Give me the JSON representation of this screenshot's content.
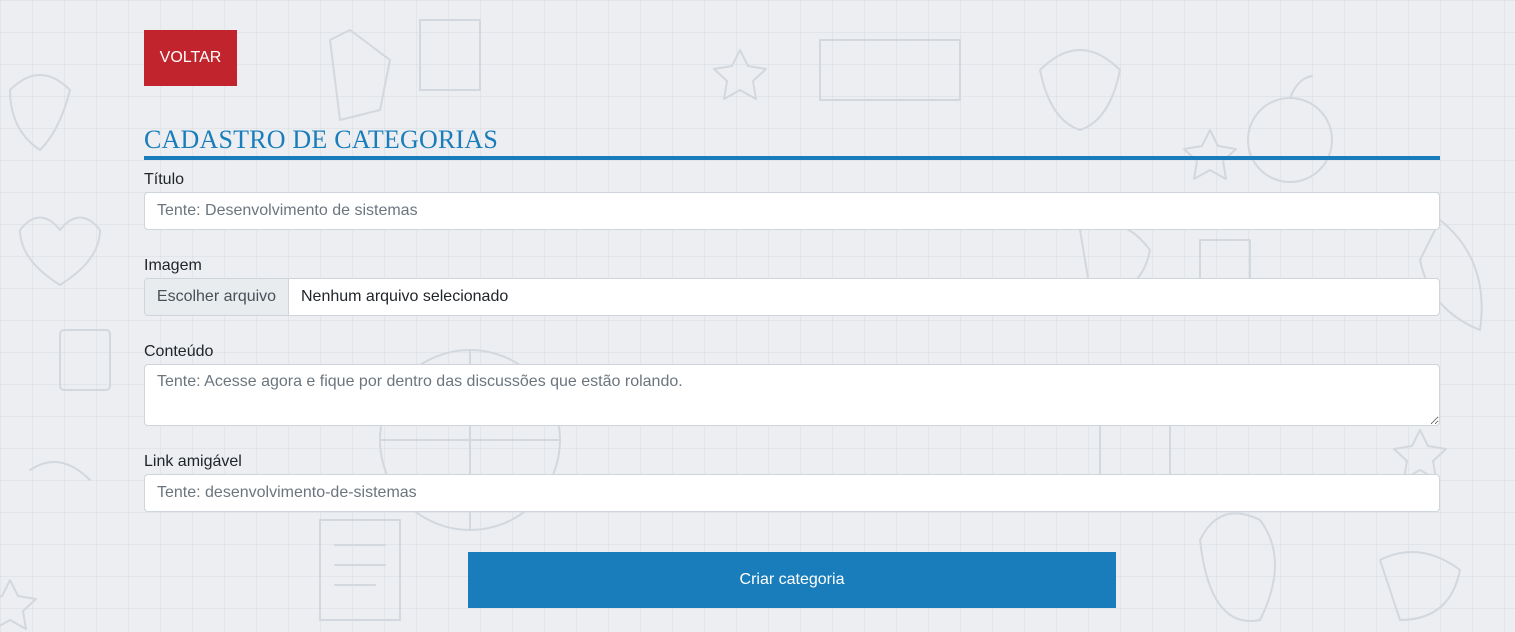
{
  "back_button": {
    "label": "VOLTAR"
  },
  "page_title": "CADASTRO DE CATEGORIAS",
  "form": {
    "title_field": {
      "label": "Título",
      "placeholder": "Tente: Desenvolvimento de sistemas",
      "value": ""
    },
    "image_field": {
      "label": "Imagem",
      "button_label": "Escolher arquivo",
      "file_status": "Nenhum arquivo selecionado"
    },
    "content_field": {
      "label": "Conteúdo",
      "placeholder": "Tente: Acesse agora e fique por dentro das discussões que estão rolando.",
      "value": ""
    },
    "link_field": {
      "label": "Link amigável",
      "placeholder": "Tente: desenvolvimento-de-sistemas",
      "value": ""
    },
    "submit_label": "Criar categoria"
  },
  "colors": {
    "back_button": "#c1242c",
    "accent": "#1a7dbb",
    "background": "#eceef1"
  }
}
